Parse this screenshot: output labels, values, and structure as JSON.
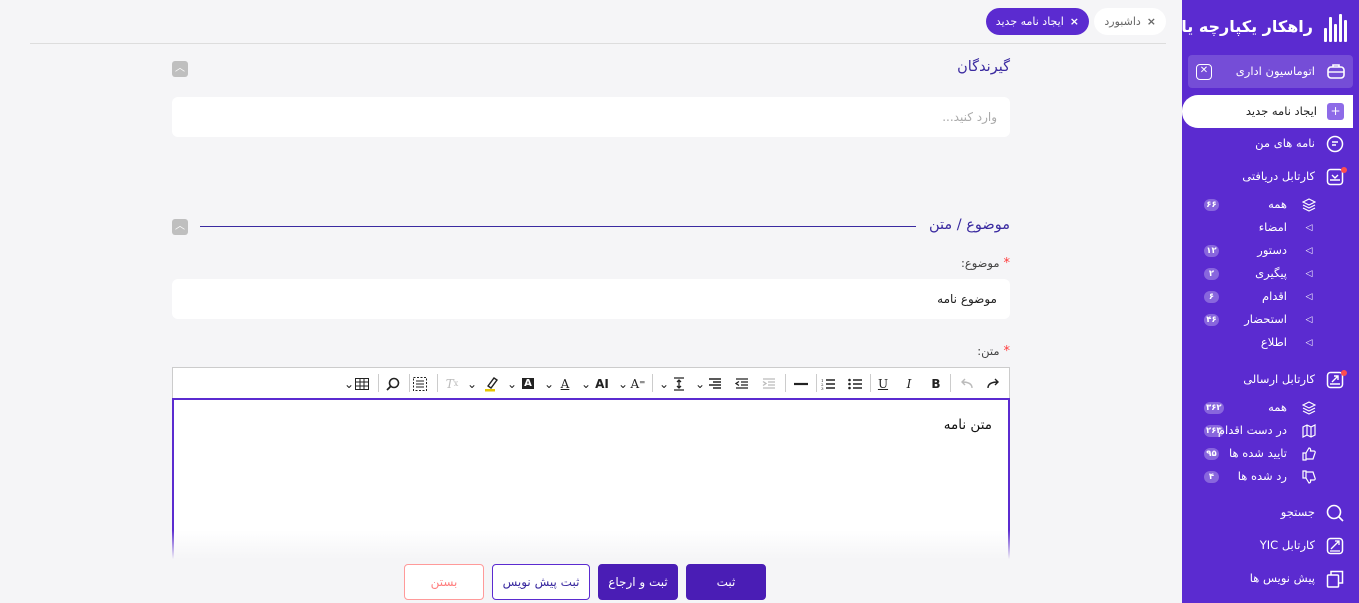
{
  "app": {
    "title": "راهکار یکپارچه یار"
  },
  "tabs": [
    {
      "label": "داشبورد",
      "close": "×"
    },
    {
      "label": "ایجاد نامه جدید",
      "close": "×"
    }
  ],
  "sidebar": {
    "group": {
      "label": "اتوماسیون اداری",
      "icon": "briefcase-icon"
    },
    "current": {
      "label": "ایجاد نامه جدید",
      "icon": "calendar-plus-icon"
    },
    "items": [
      {
        "label": "نامه های من",
        "icon": "letters-icon"
      },
      {
        "label": "کارتابل دریافتی",
        "icon": "inbox-icon"
      },
      {
        "label": "همه",
        "badge": "۶۶",
        "icon": "layers-icon"
      },
      {
        "label": "امضاء",
        "badge": "",
        "icon": "chevron-left-icon"
      },
      {
        "label": "دستور",
        "badge": "۱۲",
        "icon": "chevron-left-icon"
      },
      {
        "label": "پیگیری",
        "badge": "۲",
        "icon": "chevron-left-icon"
      },
      {
        "label": "اقدام",
        "badge": "۶",
        "icon": "chevron-left-icon"
      },
      {
        "label": "استحضار",
        "badge": "۴۶",
        "icon": "chevron-left-icon"
      },
      {
        "label": "اطلاع",
        "badge": "",
        "icon": "chevron-left-icon"
      },
      {
        "label": "کارتابل ارسالی",
        "icon": "outbox-icon"
      },
      {
        "label": "همه",
        "badge": "۳۶۲",
        "icon": "layers-icon"
      },
      {
        "label": "در دست اقدام",
        "badge": "۲۶۳",
        "icon": "map-icon"
      },
      {
        "label": "تایید شده ها",
        "badge": "۹۵",
        "icon": "thumbs-up-icon"
      },
      {
        "label": "رد شده ها",
        "badge": "۴",
        "icon": "thumbs-down-icon"
      },
      {
        "label": "جستجو",
        "icon": "search-icon"
      },
      {
        "label": "کارتابل YIC",
        "icon": "yic-icon"
      },
      {
        "label": "پیش نویس ها",
        "icon": "drafts-icon"
      }
    ]
  },
  "recipients": {
    "title": "گیرندگان",
    "placeholder": "وارد کنید..."
  },
  "subject_section": {
    "title": "موضوع / متن"
  },
  "subject": {
    "label": "موضوع:",
    "value": "موضوع نامه"
  },
  "body": {
    "label": "متن:",
    "value": "متن نامه"
  },
  "required_mark": "*",
  "buttons": {
    "submit": "ثبت",
    "submit_refer": "ثبت و ارجاع",
    "save_draft": "ثبت پیش نویس",
    "close": "بستن"
  },
  "colors": {
    "primary": "#5b2bd0",
    "danger": "#ff4d4f"
  }
}
